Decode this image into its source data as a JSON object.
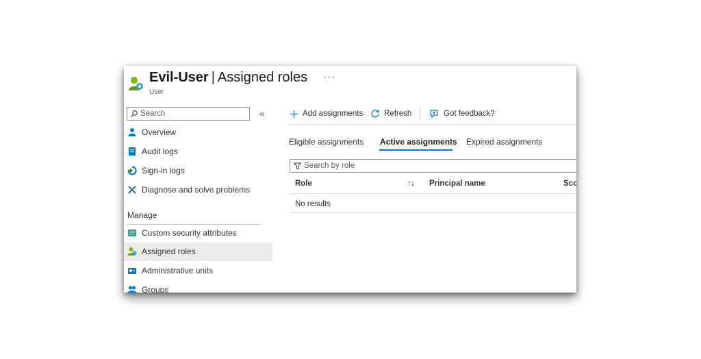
{
  "header": {
    "resource_name": "Evil-User",
    "separator": "|",
    "page_title": "Assigned roles",
    "more_label": "···",
    "subtitle": "User"
  },
  "sidebar": {
    "search_placeholder": "Search",
    "collapse_label": "«",
    "items": [
      {
        "label": "Overview",
        "icon": "user-icon"
      },
      {
        "label": "Audit logs",
        "icon": "audit-log-icon"
      },
      {
        "label": "Sign-in logs",
        "icon": "sign-in-icon"
      },
      {
        "label": "Diagnose and solve problems",
        "icon": "wrench-icon"
      }
    ],
    "section_manage": "Manage",
    "manage_items": [
      {
        "label": "Custom security attributes",
        "icon": "attributes-icon"
      },
      {
        "label": "Assigned roles",
        "icon": "assigned-roles-icon",
        "active": true
      },
      {
        "label": "Administrative units",
        "icon": "admin-units-icon"
      },
      {
        "label": "Groups",
        "icon": "groups-icon"
      }
    ]
  },
  "toolbar": {
    "add_label": "Add assignments",
    "refresh_label": "Refresh",
    "feedback_label": "Got feedback?"
  },
  "tabs": [
    {
      "label": "Eligible assignments"
    },
    {
      "label": "Active assignments",
      "active": true
    },
    {
      "label": "Expired assignments"
    }
  ],
  "filter": {
    "placeholder": "Search by role"
  },
  "table": {
    "columns": [
      "Role",
      "Principal name",
      "Sco"
    ],
    "empty_text": "No results"
  },
  "colors": {
    "accent": "#0078d4",
    "active_bg": "#edebe9"
  }
}
